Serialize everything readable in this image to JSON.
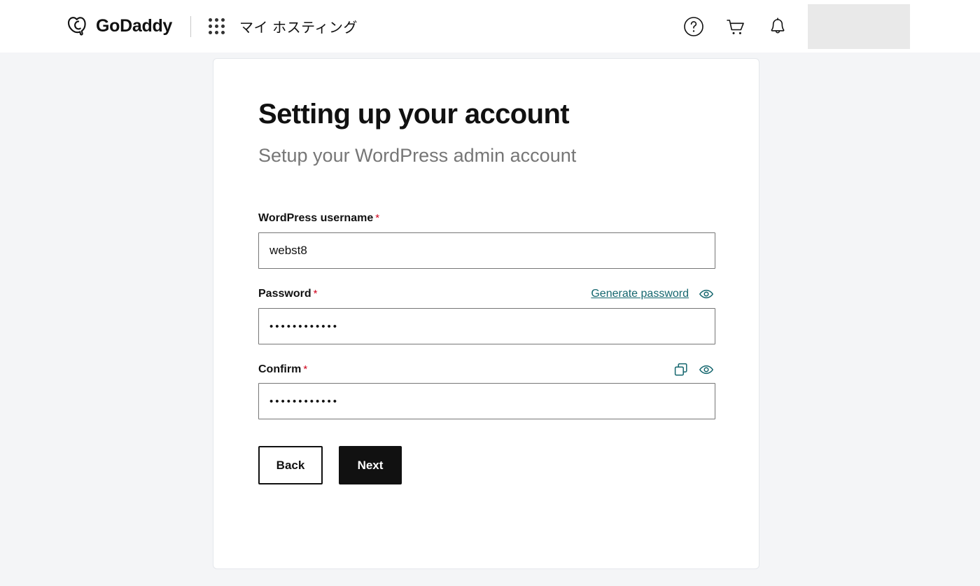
{
  "header": {
    "brand_name": "GoDaddy",
    "logo_icon": "godaddy-heart-logo",
    "apps_icon": "apps-grid-icon",
    "section_label": "マイ ホスティング",
    "help_icon": "help-circle-icon",
    "cart_icon": "shopping-cart-icon",
    "notifications_icon": "bell-icon",
    "account_placeholder": ""
  },
  "card": {
    "title": "Setting up your account",
    "subtitle": "Setup your WordPress admin account",
    "fields": {
      "username": {
        "label": "WordPress username",
        "required_marker": "*",
        "value": "webst8",
        "placeholder": ""
      },
      "password": {
        "label": "Password",
        "required_marker": "*",
        "value": "••••••••••••",
        "placeholder": "",
        "generate_label": "Generate password",
        "show_icon": "eye-icon"
      },
      "confirm": {
        "label": "Confirm",
        "required_marker": "*",
        "value": "••••••••••••",
        "placeholder": "",
        "copy_icon": "copy-icon",
        "show_icon": "eye-icon"
      }
    },
    "buttons": {
      "back": "Back",
      "next": "Next"
    }
  },
  "colors": {
    "page_background": "#f4f5f7",
    "card_background": "#ffffff",
    "accent_teal": "#14666e",
    "required_red": "#d0021b",
    "primary_button": "#111111",
    "muted_text": "#767676"
  }
}
